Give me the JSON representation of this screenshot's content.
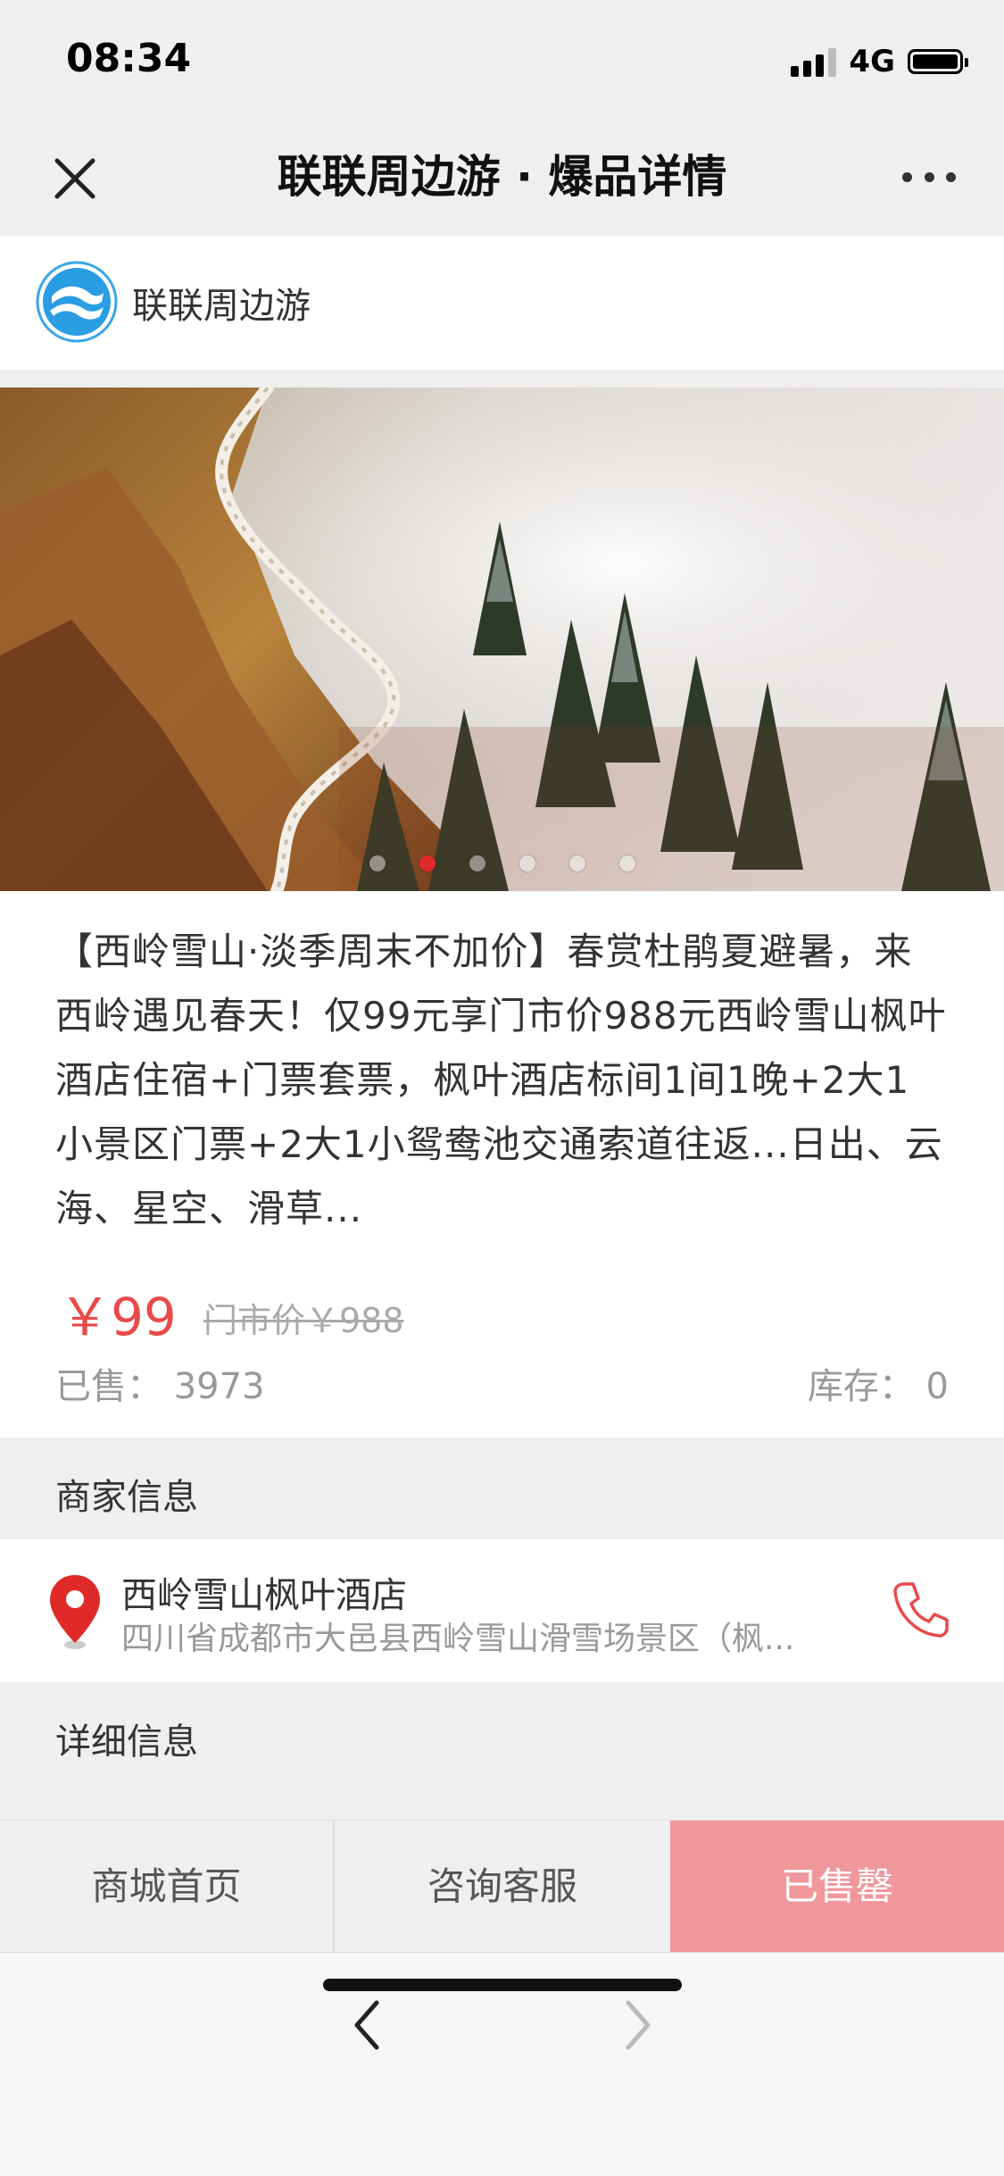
{
  "status_bar": {
    "time": "08:34",
    "network": "4G",
    "signal_bars_filled": 3
  },
  "nav": {
    "title": "联联周边游 · 爆品详情",
    "close_icon": "close-icon",
    "more_icon": "more-icon"
  },
  "shop": {
    "name": "联联周边游",
    "logo_icon": "shop-logo"
  },
  "banner": {
    "image": "mountain-trail-photo",
    "slide_count": 6,
    "active_slide": 2
  },
  "product": {
    "title": "【西岭雪山·淡季周末不加价】春赏杜鹃夏避暑，来西岭遇见春天！仅99元享门市价988元西岭雪山枫叶酒店住宿+门票套票，枫叶酒店标间1间1晚+2大1小景区门票+2大1小鸳鸯池交通索道往返...日出、云海、星空、滑草...",
    "price": "￥99",
    "original_price": "门市价￥988",
    "sold_label": "已售：",
    "sold_count": "3973",
    "stock_label": "库存：",
    "stock_count": "0"
  },
  "merchant_section": {
    "header": "商家信息",
    "name": "西岭雪山枫叶酒店",
    "address": "四川省成都市大邑县西岭雪山滑雪场景区（枫...",
    "location_icon": "location-pin-icon",
    "phone_icon": "phone-icon"
  },
  "detail_section": {
    "header": "详细信息"
  },
  "bottom_bar": {
    "home_label": "商城首页",
    "service_label": "咨询客服",
    "sold_out_label": "已售罄"
  },
  "browser_bar": {
    "back_icon": "chevron-left-icon",
    "forward_icon": "chevron-right-icon"
  },
  "colors": {
    "accent_red": "#e84a4a",
    "sold_out_bg": "#f0979c",
    "page_bg": "#efefef"
  }
}
